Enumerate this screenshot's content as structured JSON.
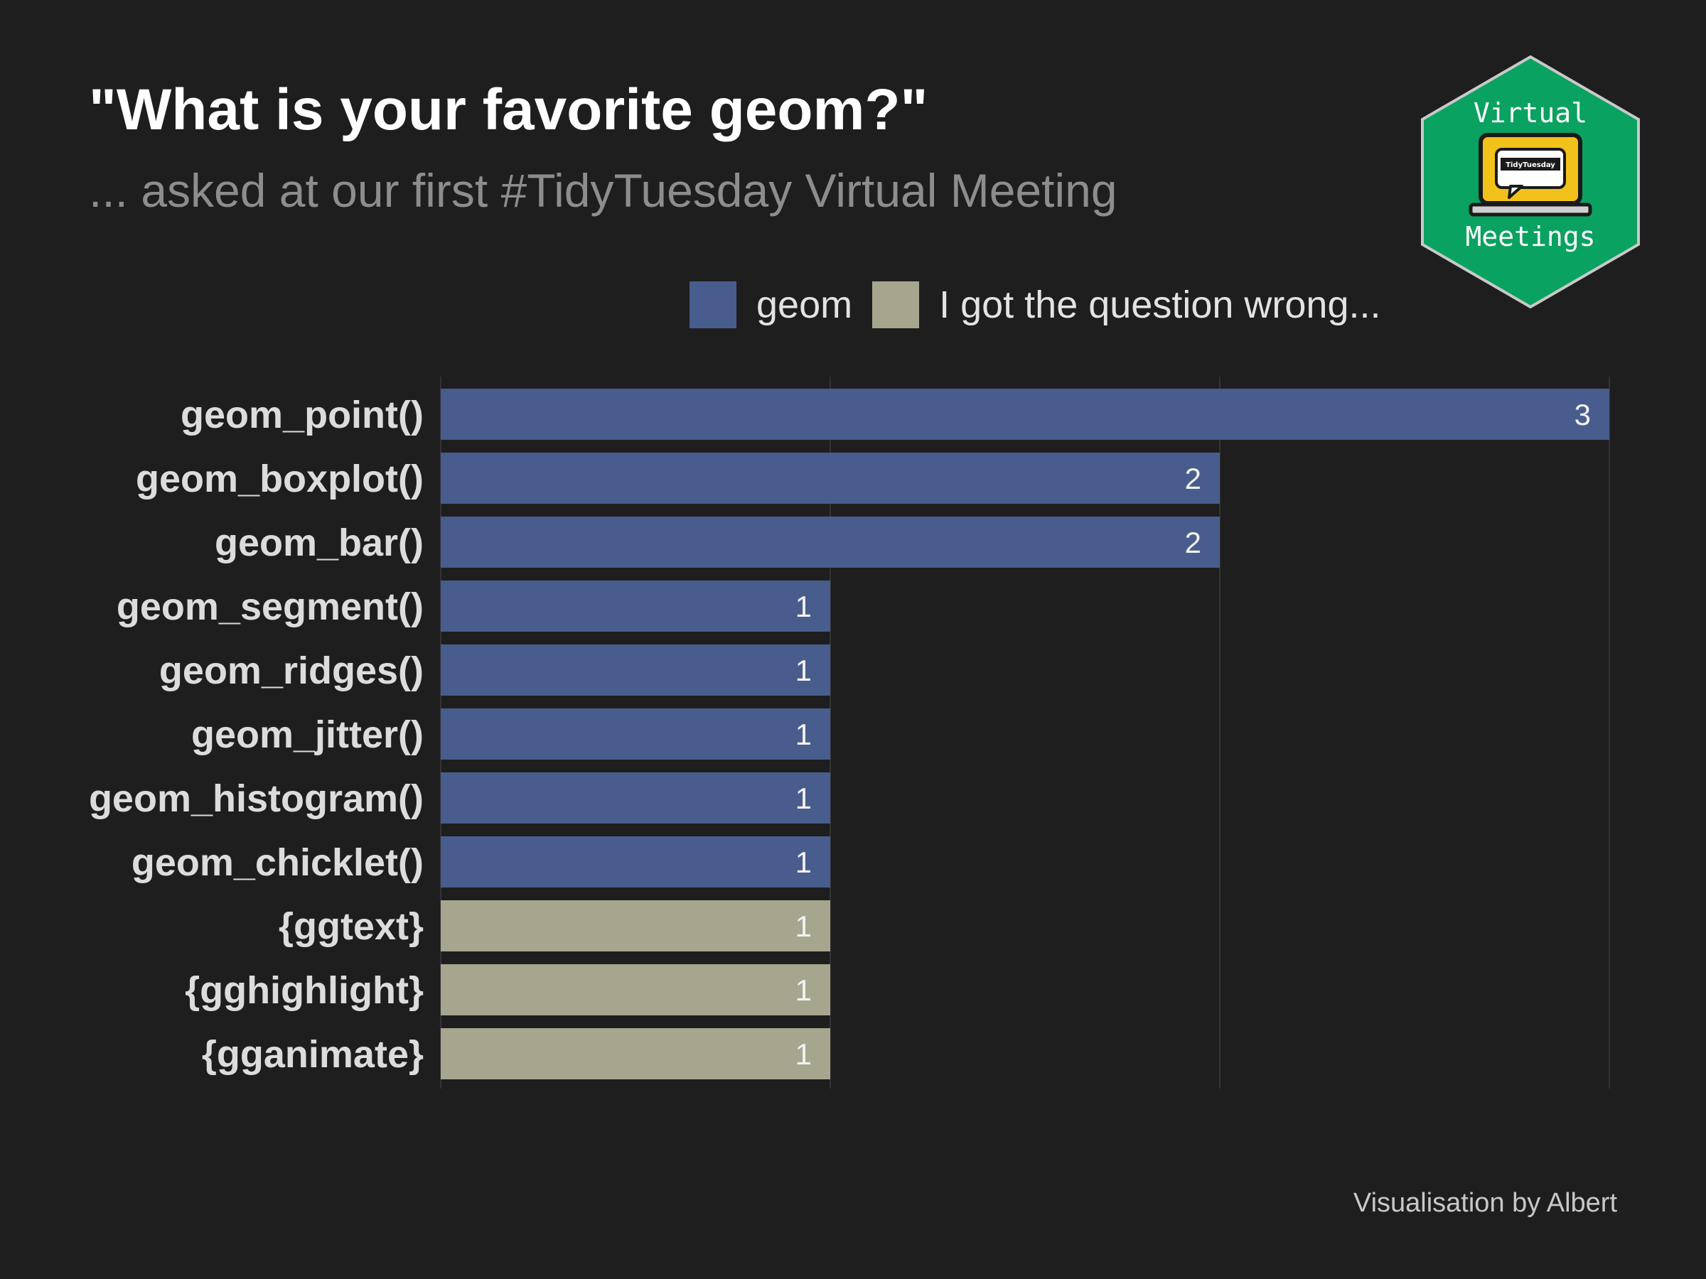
{
  "header": {
    "title": "\"What is your favorite geom?\"",
    "subtitle": "... asked at our first #TidyTuesday Virtual Meeting"
  },
  "badge": {
    "top_text": "Virtual",
    "bottom_text": "Meetings",
    "screen_text": "TidyTuesday",
    "colors": {
      "hex": "#0aa260",
      "laptop": "#f2c21b"
    }
  },
  "legend": [
    {
      "label": "geom",
      "color": "#485d8d"
    },
    {
      "label": "I got the question wrong...",
      "color": "#a6a68e"
    }
  ],
  "chart_data": {
    "type": "bar",
    "orientation": "horizontal",
    "title": "\"What is your favorite geom?\"",
    "subtitle": "... asked at our first #TidyTuesday Virtual Meeting",
    "xlim": [
      0,
      3
    ],
    "grid": true,
    "legend_position": "top",
    "series_colors": {
      "geom": "#485d8d",
      "I got the question wrong...": "#a6a68e"
    },
    "bars": [
      {
        "label": "geom_point()",
        "value": 3,
        "group": "geom"
      },
      {
        "label": "geom_boxplot()",
        "value": 2,
        "group": "geom"
      },
      {
        "label": "geom_bar()",
        "value": 2,
        "group": "geom"
      },
      {
        "label": "geom_segment()",
        "value": 1,
        "group": "geom"
      },
      {
        "label": "geom_ridges()",
        "value": 1,
        "group": "geom"
      },
      {
        "label": "geom_jitter()",
        "value": 1,
        "group": "geom"
      },
      {
        "label": "geom_histogram()",
        "value": 1,
        "group": "geom"
      },
      {
        "label": "geom_chicklet()",
        "value": 1,
        "group": "geom"
      },
      {
        "label": "{ggtext}",
        "value": 1,
        "group": "I got the question wrong..."
      },
      {
        "label": "{gghighlight}",
        "value": 1,
        "group": "I got the question wrong..."
      },
      {
        "label": "{gganimate}",
        "value": 1,
        "group": "I got the question wrong..."
      }
    ]
  },
  "footer": {
    "caption": "Visualisation by Albert"
  }
}
